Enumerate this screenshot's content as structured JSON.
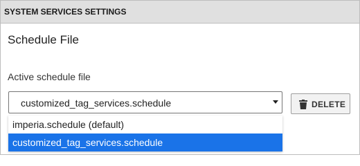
{
  "header": {
    "title": "SYSTEM SERVICES SETTINGS"
  },
  "section": {
    "title": "Schedule File"
  },
  "field": {
    "label": "Active schedule file",
    "selected_value": "customized_tag_services.schedule"
  },
  "delete_button": {
    "label": "DELETE",
    "icon": "trash-icon"
  },
  "dropdown": {
    "options": [
      {
        "label": "imperia.schedule (default)",
        "selected": false
      },
      {
        "label": "customized_tag_services.schedule",
        "selected": true
      }
    ]
  },
  "colors": {
    "header_bg": "#e0e0e0",
    "highlight": "#1a73e8",
    "border": "#bdbdbd"
  }
}
